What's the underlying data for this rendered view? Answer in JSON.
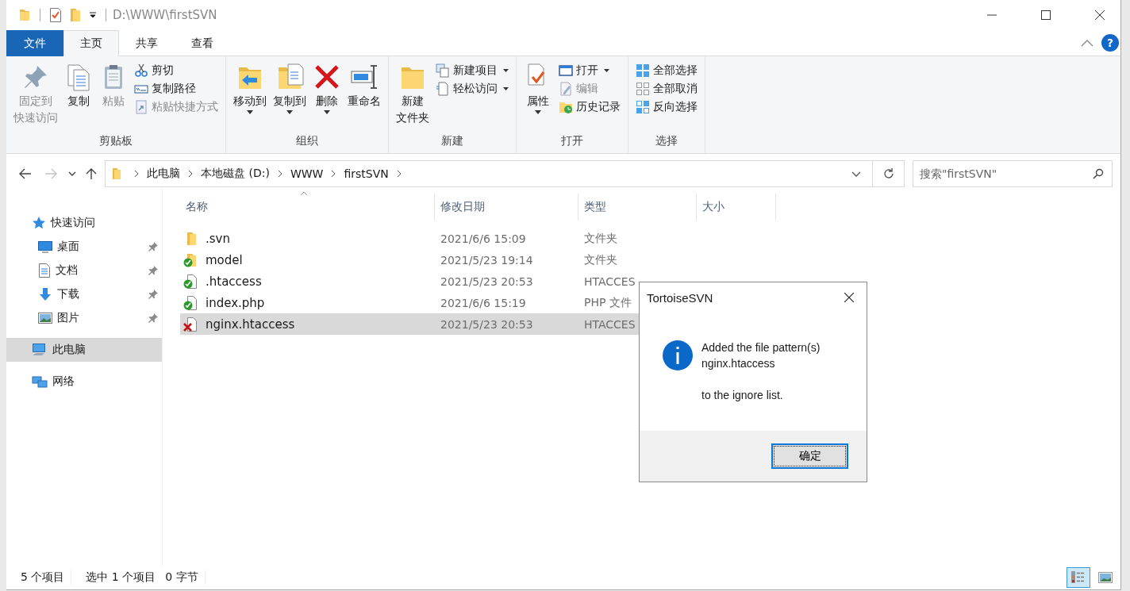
{
  "window": {
    "title": "D:\\WWW\\firstSVN"
  },
  "menu_tabs": [
    {
      "label": "文件",
      "kind": "file",
      "selected": false
    },
    {
      "label": "主页",
      "kind": "tab",
      "selected": true
    },
    {
      "label": "共享",
      "kind": "tab",
      "selected": false
    },
    {
      "label": "查看",
      "kind": "tab",
      "selected": false
    }
  ],
  "help": "?",
  "ribbon_groups": [
    {
      "label": "剪贴板",
      "items": [
        {
          "label_lines": [
            "固定到",
            "快速访问"
          ],
          "kind": "large",
          "disabled": true,
          "dropdown": false
        },
        {
          "label_lines": [
            "复制"
          ],
          "kind": "large",
          "disabled": false,
          "dropdown": false
        },
        {
          "label_lines": [
            "粘贴"
          ],
          "kind": "large",
          "disabled": true,
          "dropdown": false
        },
        {
          "label": "剪切",
          "kind": "small",
          "disabled": false,
          "dropdown": false
        },
        {
          "label": "复制路径",
          "kind": "small",
          "disabled": false,
          "dropdown": false
        },
        {
          "label": "粘贴快捷方式",
          "kind": "small",
          "disabled": true,
          "dropdown": false
        }
      ]
    },
    {
      "label": "组织",
      "items": [
        {
          "label_lines": [
            "移动到"
          ],
          "kind": "large",
          "disabled": false,
          "dropdown": true
        },
        {
          "label_lines": [
            "复制到"
          ],
          "kind": "large",
          "disabled": false,
          "dropdown": true
        },
        {
          "label_lines": [
            "删除"
          ],
          "kind": "large",
          "disabled": false,
          "dropdown": true
        },
        {
          "label_lines": [
            "重命名"
          ],
          "kind": "large",
          "disabled": false,
          "dropdown": false
        }
      ]
    },
    {
      "label": "新建",
      "items": [
        {
          "label_lines": [
            "新建",
            "文件夹"
          ],
          "kind": "large",
          "disabled": false,
          "dropdown": false
        },
        {
          "label": "新建项目",
          "kind": "small",
          "disabled": false,
          "dropdown": true
        },
        {
          "label": "轻松访问",
          "kind": "small",
          "disabled": false,
          "dropdown": true
        }
      ]
    },
    {
      "label": "打开",
      "items": [
        {
          "label_lines": [
            "属性"
          ],
          "kind": "large",
          "disabled": false,
          "dropdown": true
        },
        {
          "label": "打开",
          "kind": "small",
          "disabled": false,
          "dropdown": true
        },
        {
          "label": "编辑",
          "kind": "small",
          "disabled": true,
          "dropdown": false
        },
        {
          "label": "历史记录",
          "kind": "small",
          "disabled": false,
          "dropdown": false
        }
      ]
    },
    {
      "label": "选择",
      "items": [
        {
          "label": "全部选择",
          "kind": "small",
          "disabled": false,
          "dropdown": false
        },
        {
          "label": "全部取消",
          "kind": "small",
          "disabled": false,
          "dropdown": false
        },
        {
          "label": "反向选择",
          "kind": "small",
          "disabled": false,
          "dropdown": false
        }
      ]
    }
  ],
  "nav": [
    {
      "kind": "back",
      "disabled": false
    },
    {
      "kind": "forward",
      "disabled": true
    },
    {
      "kind": "recent",
      "disabled": false
    },
    {
      "kind": "up",
      "disabled": false
    }
  ],
  "breadcrumbs": [
    "此电脑",
    "本地磁盘 (D:)",
    "WWW",
    "firstSVN"
  ],
  "search": {
    "placeholder": "搜索\"firstSVN\""
  },
  "sidebar": {
    "items": [
      {
        "label": "快速访问",
        "kind": "star",
        "selected": false,
        "children": [
          {
            "label": "桌面",
            "kind": "desktop",
            "pinned": true,
            "selected": false
          },
          {
            "label": "文档",
            "kind": "document",
            "pinned": true,
            "selected": false
          },
          {
            "label": "下载",
            "kind": "download",
            "pinned": true,
            "selected": false
          },
          {
            "label": "图片",
            "kind": "pictures",
            "pinned": true,
            "selected": false
          }
        ]
      },
      {
        "label": "此电脑",
        "kind": "computer",
        "selected": true
      },
      {
        "label": "网络",
        "kind": "network",
        "selected": false
      }
    ]
  },
  "table": {
    "columns": [
      "名称",
      "修改日期",
      "类型",
      "大小"
    ],
    "rows": [
      {
        "name": ".svn",
        "kind": "folder",
        "svn_normal": false,
        "svn_deleted": false,
        "date": "2021/6/6 15:09",
        "type": "文件夹",
        "selected": false
      },
      {
        "name": "model",
        "kind": "folder",
        "svn_normal": true,
        "svn_deleted": false,
        "date": "2021/5/23 19:14",
        "type": "文件夹",
        "selected": false
      },
      {
        "name": ".htaccess",
        "kind": "file",
        "svn_normal": true,
        "svn_deleted": false,
        "date": "2021/5/23 20:53",
        "type": "HTACCES",
        "selected": false
      },
      {
        "name": "index.php",
        "kind": "file",
        "svn_normal": true,
        "svn_deleted": false,
        "date": "2021/6/6 15:19",
        "type": "PHP 文件",
        "selected": false
      },
      {
        "name": "nginx.htaccess",
        "kind": "file",
        "svn_normal": false,
        "svn_deleted": true,
        "date": "2021/5/23 20:53",
        "type": "HTACCES",
        "selected": true
      }
    ]
  },
  "status_bar": {
    "count": "5 个项目",
    "selection": "选中 1 个项目",
    "size": "0 字节"
  },
  "views": [
    {
      "kind": "details",
      "selected": true
    },
    {
      "kind": "large-icons",
      "selected": false
    }
  ],
  "dialog": {
    "title": "TortoiseSVN",
    "message": "Added the file pattern(s)\nnginx.htaccess\n\nto the ignore list.",
    "button": "确定"
  }
}
